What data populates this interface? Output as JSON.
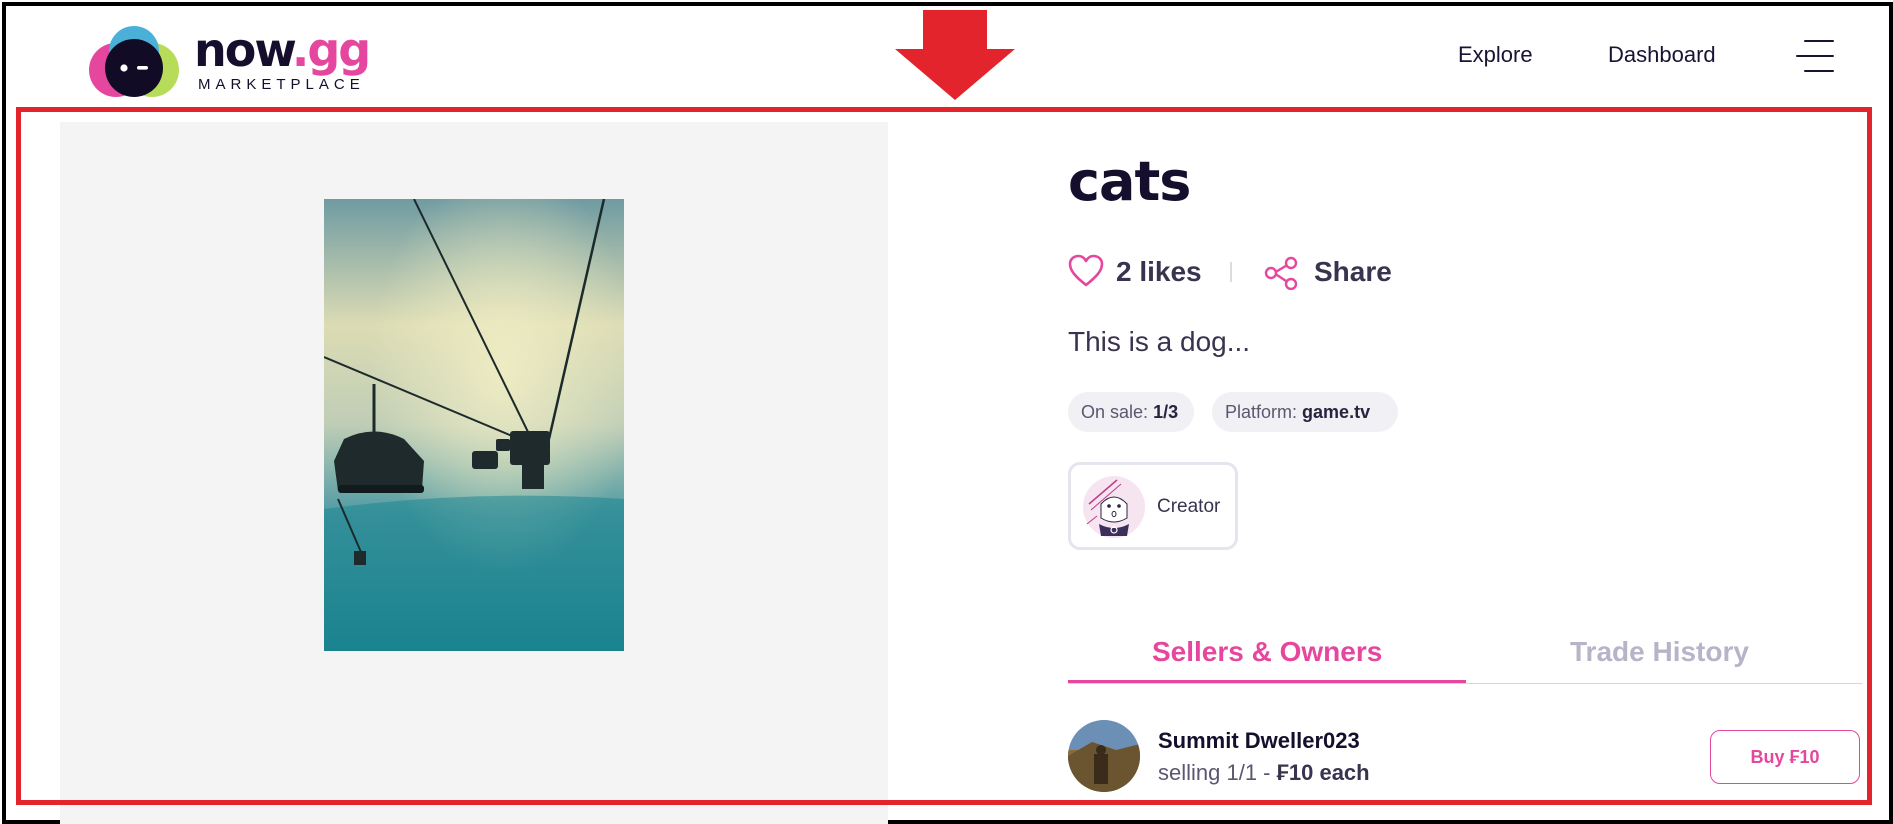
{
  "header": {
    "logo_word": "now",
    "logo_suffix": ".gg",
    "logo_subtitle": "MARKETPLACE",
    "nav": {
      "explore": "Explore",
      "dashboard": "Dashboard"
    },
    "menu_icon": "hamburger-menu-icon"
  },
  "annotation": {
    "arrow_color": "#e4242c",
    "box_color": "#e4242c"
  },
  "item": {
    "title": "cats",
    "likes": "2 likes",
    "share": "Share",
    "description": "This is a dog...",
    "on_sale_label": "On sale:",
    "on_sale_value": "1/3",
    "platform_label": "Platform:",
    "platform_value": "game.tv",
    "creator_label": "Creator"
  },
  "tabs": {
    "sellers": "Sellers & Owners",
    "history": "Trade History",
    "active": "sellers"
  },
  "sellers": [
    {
      "name": "Summit Dweller023",
      "selling_prefix": "selling 1/1 -",
      "price_each": "₣10 each",
      "buy_label": "Buy ₣10"
    }
  ],
  "colors": {
    "accent": "#e6479e",
    "text_dark": "#150f2d",
    "muted": "#b8b3c9"
  }
}
